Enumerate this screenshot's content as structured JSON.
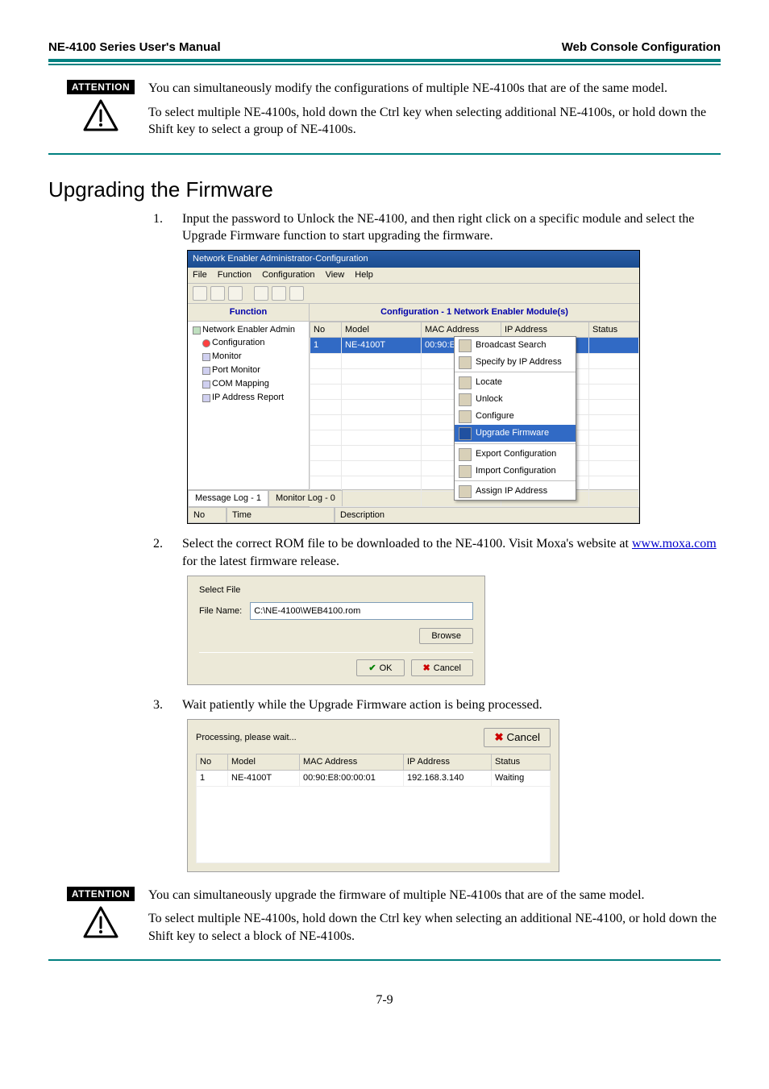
{
  "header": {
    "left": "NE-4100 Series User's Manual",
    "right": "Web Console Configuration"
  },
  "attention1": {
    "badge": "ATTENTION",
    "p1": "You can simultaneously modify the configurations of multiple NE-4100s that are of the same model.",
    "p2": "To select multiple NE-4100s, hold down the Ctrl key when selecting additional NE-4100s, or hold down the Shift key to select a group of NE-4100s."
  },
  "section_title": "Upgrading the Firmware",
  "step1": {
    "num": "1.",
    "text": "Input the password to Unlock the NE-4100, and then right click on a specific module and select the Upgrade Firmware function to start upgrading the firmware."
  },
  "fig1": {
    "title": "Network Enabler Administrator-Configuration",
    "menu": {
      "file": "File",
      "function": "Function",
      "configuration": "Configuration",
      "view": "View",
      "help": "Help"
    },
    "tree_head": "Function",
    "tree_root": "Network Enabler Admin",
    "tree_items": [
      "Configuration",
      "Monitor",
      "Port Monitor",
      "COM Mapping",
      "IP Address Report"
    ],
    "grid_title": "Configuration - 1 Network Enabler Module(s)",
    "cols": {
      "no": "No",
      "model": "Model",
      "mac": "MAC Address",
      "ip": "IP Address",
      "status": "Status"
    },
    "row": {
      "no": "1",
      "model": "NE-4100T",
      "mac": "00:90:E..."
    },
    "ctx": [
      "Broadcast Search",
      "Specify by IP Address",
      "Locate",
      "Unlock",
      "Configure",
      "Upgrade Firmware",
      "Export Configuration",
      "Import Configuration",
      "Assign IP Address"
    ],
    "msg_tab1": "Message Log - 1",
    "msg_tab2": "Monitor Log - 0",
    "msg_cols": {
      "no": "No",
      "time": "Time",
      "desc": "Description"
    }
  },
  "step2": {
    "num": "2.",
    "text_a": "Select the correct ROM file to be downloaded to the NE-4100. Visit Moxa's website at ",
    "link": "www.moxa.com",
    "text_b": " for the latest firmware release."
  },
  "fig2": {
    "group": "Select File",
    "filename_label": "File Name:",
    "filename_value": "C:\\NE-4100\\WEB4100.rom",
    "browse": "Browse",
    "ok": "OK",
    "cancel": "Cancel"
  },
  "step3": {
    "num": "3.",
    "text": "Wait patiently while the Upgrade Firmware action is being processed."
  },
  "fig3": {
    "processing": "Processing, please wait...",
    "cancel": "Cancel",
    "cols": {
      "no": "No",
      "model": "Model",
      "mac": "MAC Address",
      "ip": "IP Address",
      "status": "Status"
    },
    "row": {
      "no": "1",
      "model": "NE-4100T",
      "mac": "00:90:E8:00:00:01",
      "ip": "192.168.3.140",
      "status": "Waiting"
    }
  },
  "attention2": {
    "badge": "ATTENTION",
    "p1": "You can simultaneously upgrade the firmware of multiple NE-4100s that are of the same model.",
    "p2": "To select multiple NE-4100s, hold down the Ctrl key when selecting an additional NE-4100, or hold down the Shift key to select a block of NE-4100s."
  },
  "page_number": "7-9"
}
